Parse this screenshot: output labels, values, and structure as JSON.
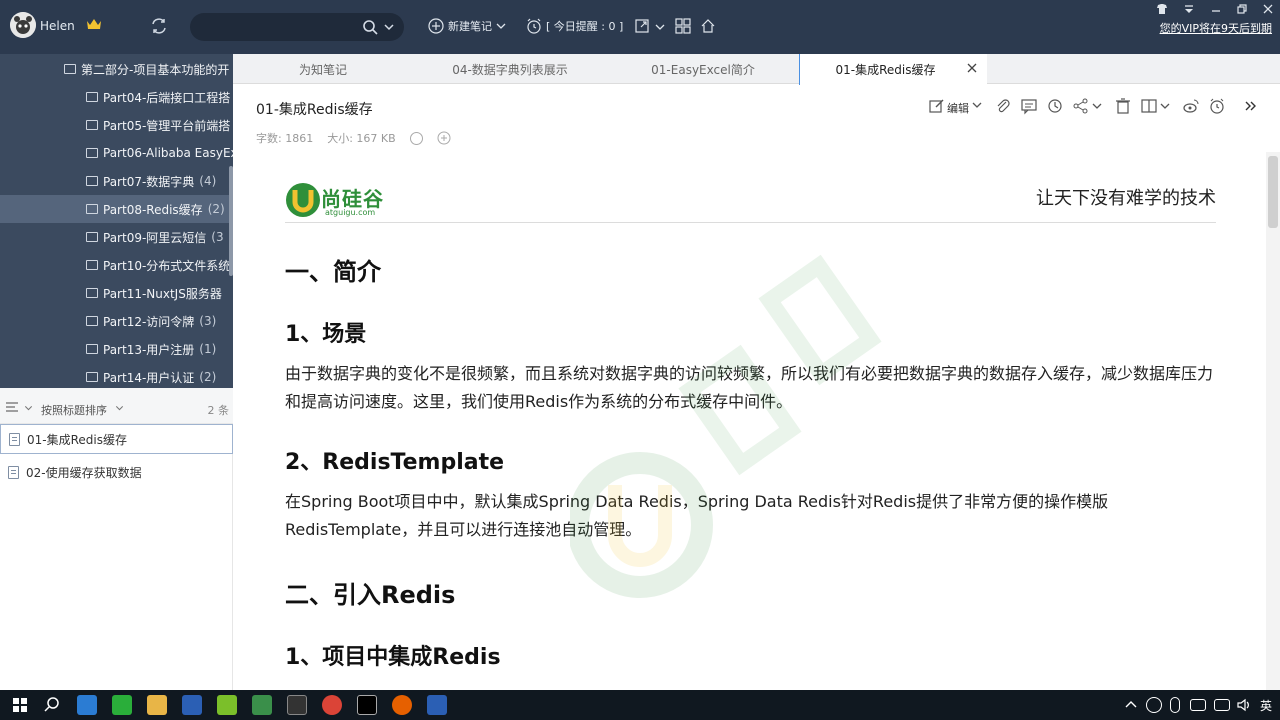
{
  "topbar": {
    "username": "Helen",
    "search_placeholder": "",
    "new_note_label": "新建笔记",
    "reminder_label": "[ 今日提醒 : 0 ]",
    "vip_notice": "您的VIP将在9天后到期"
  },
  "tree": {
    "items": [
      {
        "label": "第二部分-项目基本功能的开",
        "count": ""
      },
      {
        "label": "Part04-后端接口工程搭",
        "count": ""
      },
      {
        "label": "Part05-管理平台前端搭",
        "count": ""
      },
      {
        "label": "Part06-Alibaba EasyEx",
        "count": ""
      },
      {
        "label": "Part07-数据字典",
        "count": "(4)"
      },
      {
        "label": "Part08-Redis缓存",
        "count": "(2)"
      },
      {
        "label": "Part09-阿里云短信",
        "count": "(3"
      },
      {
        "label": "Part10-分布式文件系统",
        "count": ""
      },
      {
        "label": "Part11-NuxtJS服务器",
        "count": ""
      },
      {
        "label": "Part12-访问令牌",
        "count": "(3)"
      },
      {
        "label": "Part13-用户注册",
        "count": "(1)"
      },
      {
        "label": "Part14-用户认证",
        "count": "(2)"
      }
    ]
  },
  "notelist": {
    "sort_label": "按照标题排序",
    "count": "2 条",
    "items": [
      {
        "label": "01-集成Redis缓存"
      },
      {
        "label": "02-使用缓存获取数据"
      }
    ]
  },
  "tabs": [
    {
      "label": "为知笔记"
    },
    {
      "label": "04-数据字典列表展示"
    },
    {
      "label": "01-EasyExcel简介"
    },
    {
      "label": "01-集成Redis缓存"
    }
  ],
  "note": {
    "title": "01-集成Redis缓存",
    "word_count": "字数: 1861",
    "size": "大小: 167 KB",
    "edit_label": "编辑"
  },
  "doc": {
    "logo_text": "尚硅谷",
    "logo_url_text": "atguigu.com",
    "slogan": "让天下没有难学的技术",
    "h1_intro": "一、简介",
    "h2_scene": "1、场景",
    "p_scene": "由于数据字典的变化不是很频繁，而且系统对数据字典的访问较频繁，所以我们有必要把数据字典的数据存入缓存，减少数据库压力和提高访问速度。这里，我们使用Redis作为系统的分布式缓存中间件。",
    "h2_template": "2、RedisTemplate",
    "p_template": "在Spring Boot项目中中，默认集成Spring Data Redis，Spring Data Redis针对Redis提供了非常方便的操作模版RedisTemplate，并且可以进行连接池自动管理。",
    "h1_import": "二、引入Redis",
    "h2_project": "1、项目中集成Redis"
  },
  "taskbar": {
    "ime": "英"
  }
}
